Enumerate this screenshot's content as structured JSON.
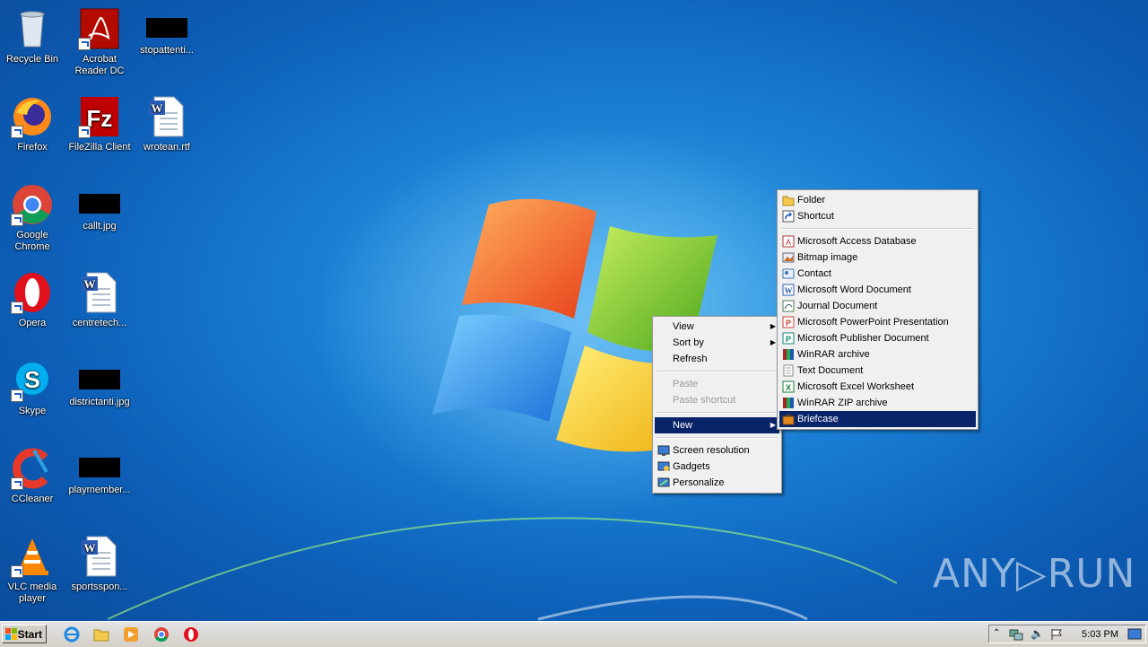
{
  "desktop_icons": [
    {
      "label": "Recycle Bin",
      "icon": "recycle-bin-icon"
    },
    {
      "label": "Acrobat Reader DC",
      "icon": "acrobat-icon"
    },
    {
      "label": "stopattenti...",
      "icon": "redacted-file-icon"
    },
    {
      "label": "Firefox",
      "icon": "firefox-icon"
    },
    {
      "label": "FileZilla Client",
      "icon": "filezilla-icon"
    },
    {
      "label": "wrotean.rtf",
      "icon": "word-document-icon"
    },
    {
      "label": "Google Chrome",
      "icon": "chrome-icon"
    },
    {
      "label": "callt.jpg",
      "icon": "redacted-file-icon"
    },
    {
      "label": "Opera",
      "icon": "opera-icon"
    },
    {
      "label": "centretech...",
      "icon": "word-document-icon"
    },
    {
      "label": "Skype",
      "icon": "skype-icon"
    },
    {
      "label": "districtanti.jpg",
      "icon": "redacted-file-icon"
    },
    {
      "label": "CCleaner",
      "icon": "ccleaner-icon"
    },
    {
      "label": "playmember...",
      "icon": "redacted-file-icon"
    },
    {
      "label": "VLC media player",
      "icon": "vlc-icon"
    },
    {
      "label": "sportsspon...",
      "icon": "word-document-icon"
    }
  ],
  "context_menu": {
    "items": [
      {
        "label": "View",
        "arrow": "▶"
      },
      {
        "label": "Sort by",
        "arrow": "▶"
      },
      {
        "label": "Refresh"
      },
      {
        "label": "Paste"
      },
      {
        "label": "Paste shortcut"
      },
      {
        "label": "New",
        "arrow": "▶"
      },
      {
        "label": "Screen resolution"
      },
      {
        "label": "Gadgets"
      },
      {
        "label": "Personalize"
      }
    ]
  },
  "new_submenu": {
    "items": [
      {
        "label": "Folder"
      },
      {
        "label": "Shortcut"
      },
      {
        "label": "Microsoft Access Database"
      },
      {
        "label": "Bitmap image"
      },
      {
        "label": "Contact"
      },
      {
        "label": "Microsoft Word Document"
      },
      {
        "label": "Journal Document"
      },
      {
        "label": "Microsoft PowerPoint Presentation"
      },
      {
        "label": "Microsoft Publisher Document"
      },
      {
        "label": "WinRAR archive"
      },
      {
        "label": "Text Document"
      },
      {
        "label": "Microsoft Excel Worksheet"
      },
      {
        "label": "WinRAR ZIP archive"
      },
      {
        "label": "Briefcase"
      }
    ]
  },
  "taskbar": {
    "start_label": "Start",
    "clock": "5:03 PM",
    "pinned": [
      "internet-explorer-icon",
      "explorer-icon",
      "media-player-icon",
      "chrome-icon",
      "opera-icon"
    ]
  },
  "watermark": "ANY▷RUN",
  "colors": {
    "selection": "#0a246a",
    "menu_bg": "#f0f0f0"
  }
}
